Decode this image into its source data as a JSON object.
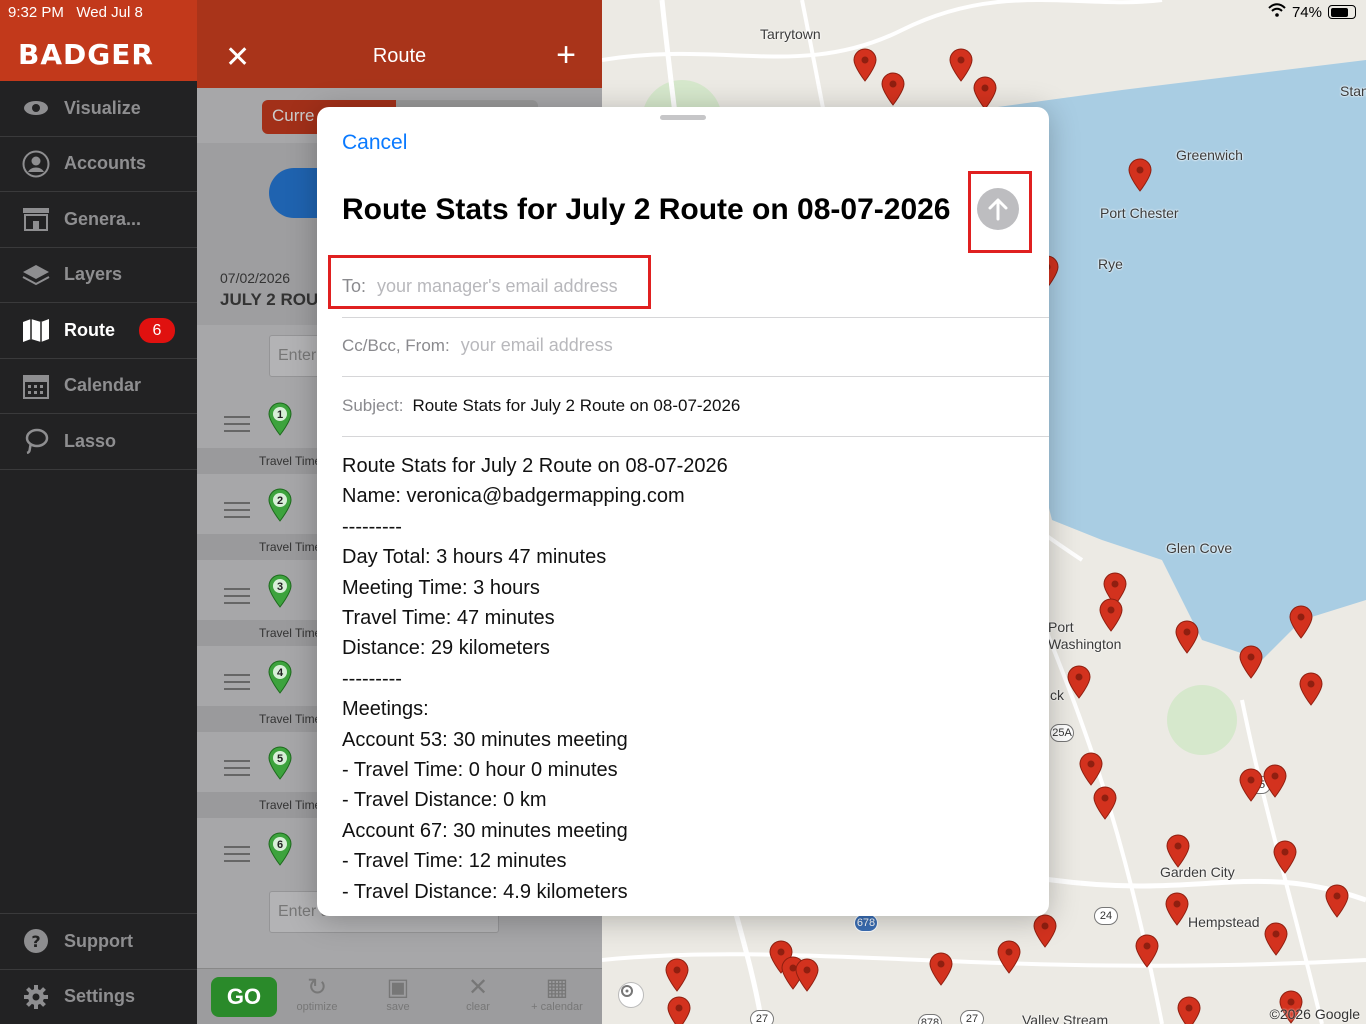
{
  "status_bar": {
    "time": "9:32 PM",
    "date": "Wed Jul 8",
    "battery": "74%"
  },
  "sidebar": {
    "brand": "BADGER",
    "items": [
      {
        "label": "Visualize",
        "icon": "eye-icon"
      },
      {
        "label": "Accounts",
        "icon": "person-icon"
      },
      {
        "label": "Genera...",
        "icon": "storefront-icon"
      },
      {
        "label": "Layers",
        "icon": "layers-icon"
      },
      {
        "label": "Route",
        "icon": "map-icon",
        "active": true,
        "badge": "6"
      },
      {
        "label": "Calendar",
        "icon": "calendar-icon"
      },
      {
        "label": "Lasso",
        "icon": "lasso-icon"
      }
    ],
    "bottom_items": [
      {
        "label": "Support",
        "icon": "question-icon"
      },
      {
        "label": "Settings",
        "icon": "gear-icon"
      }
    ]
  },
  "route_panel": {
    "title": "Route",
    "segment_current": "Curre",
    "date": "07/02/2026",
    "name": "JULY 2 ROU",
    "enter_placeholder": "Enter",
    "enter_placeholder_bottom": "Enter a",
    "stops": [
      "1",
      "2",
      "3",
      "4",
      "5",
      "6"
    ],
    "travel_label": "Travel Time",
    "toolbar": {
      "go": "GO",
      "optimize": "optimize",
      "save": "save",
      "clear": "clear",
      "calendar": "+ calendar"
    }
  },
  "map": {
    "labels": [
      "Tarrytown",
      "Greenwich",
      "Port Chester",
      "Rye",
      "Glen Cove",
      "Port Washington",
      "Garden City",
      "Hempstead",
      "Valley Stream",
      "Stan",
      "ck"
    ],
    "shields": [
      "25A",
      "25",
      "24",
      "678",
      "27",
      "878",
      "27"
    ],
    "copyright": "©2026 Google"
  },
  "modal": {
    "cancel": "Cancel",
    "title": "Route Stats for July 2 Route on 08-07-2026",
    "to_label": "To:",
    "to_placeholder": "your manager's email address",
    "cc_label": "Cc/Bcc, From:",
    "cc_placeholder": "your email address",
    "subject_label": "Subject:",
    "subject_value": "Route Stats for July 2 Route on 08-07-2026",
    "body_lines": [
      "Route Stats for July 2 Route on 08-07-2026",
      "Name: veronica@badgermapping.com",
      "---------",
      "Day Total: 3 hours 47 minutes",
      "Meeting Time: 3 hours",
      "Travel Time: 47 minutes",
      "Distance: 29 kilometers",
      "---------",
      "Meetings:",
      "Account 53: 30 minutes meeting",
      "- Travel Time: 0 hour 0 minutes",
      "- Travel Distance: 0 km",
      "Account 67: 30 minutes meeting",
      "- Travel Time: 12 minutes",
      "- Travel Distance: 4.9 kilometers"
    ]
  }
}
